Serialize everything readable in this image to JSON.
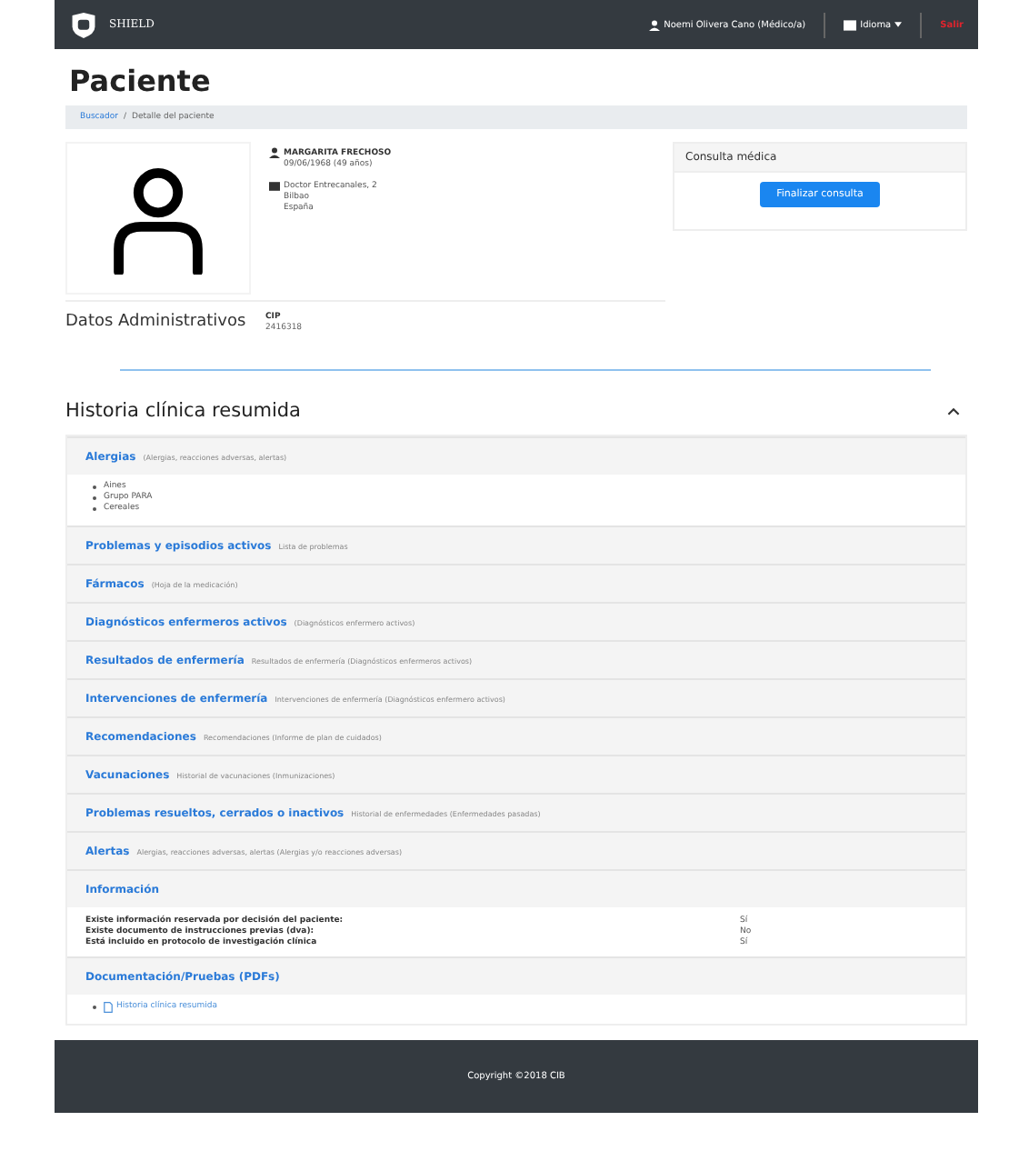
{
  "navbar": {
    "brand": "SHIELD",
    "user": "Noemi Olivera Cano (Médico/a)",
    "language": "Idioma",
    "logout": "Salir"
  },
  "page_title": "Paciente",
  "breadcrumb_separator": "/",
  "breadcrumb": [
    {
      "label": "Buscador",
      "link": true
    },
    {
      "label": "Detalle del paciente",
      "link": false
    }
  ],
  "patient": {
    "name": "MARGARITA FRECHOSO",
    "birth": "09/06/1968 (49 años)",
    "address": [
      "Doctor Entrecanales, 2",
      "Bilbao",
      "España"
    ]
  },
  "consultation": {
    "title": "Consulta médica",
    "button": "Finalizar consulta"
  },
  "admin": {
    "title": "Datos Administrativos",
    "fields": [
      {
        "label": "CIP",
        "value": "2416318"
      }
    ]
  },
  "history": {
    "title": "Historia clínica resumida",
    "expanded": true,
    "sections": [
      {
        "kind": "list",
        "title": "Alergias",
        "subtitle": "(Alergias, reacciones adversas, alertas)",
        "items": [
          "Aines",
          "Grupo PARA",
          "Cereales"
        ]
      },
      {
        "kind": "plain",
        "title": "Problemas y episodios activos",
        "subtitle": "Lista de problemas"
      },
      {
        "kind": "plain",
        "title": "Fármacos",
        "subtitle": "(Hoja de la medicación)"
      },
      {
        "kind": "plain",
        "title": "Diagnósticos enfermeros activos",
        "subtitle": "(Diagnósticos enfermero activos)"
      },
      {
        "kind": "plain",
        "title": "Resultados de enfermería",
        "subtitle": "Resultados de enfermería (Diagnósticos enfermeros activos)"
      },
      {
        "kind": "plain",
        "title": "Intervenciones de enfermería",
        "subtitle": "Intervenciones de enfermería (Diagnósticos enfermero activos)"
      },
      {
        "kind": "plain",
        "title": "Recomendaciones",
        "subtitle": "Recomendaciones (Informe de plan de cuidados)"
      },
      {
        "kind": "plain",
        "title": "Vacunaciones",
        "subtitle": "Historial de vacunaciones (Inmunizaciones)"
      },
      {
        "kind": "plain",
        "title": "Problemas resueltos, cerrados o inactivos",
        "subtitle": "Historial de enfermedades (Enfermedades pasadas)"
      },
      {
        "kind": "plain",
        "title": "Alertas",
        "subtitle": "Alergias, reacciones adversas, alertas (Alergias y/o reacciones adversas)"
      },
      {
        "kind": "info",
        "title": "Información",
        "rows": [
          {
            "label": "Existe información reservada por decisión del paciente:",
            "value": "Sí"
          },
          {
            "label": "Existe documento de instrucciones previas (dva):",
            "value": "No"
          },
          {
            "label": "Está incluido en protocolo de investigación clínica",
            "value": "Sí"
          }
        ]
      },
      {
        "kind": "links",
        "title": "Documentación/Pruebas (PDFs)",
        "links": [
          "Historia clínica resumida"
        ]
      }
    ]
  },
  "footer": "Copyright ©2018 CIB"
}
